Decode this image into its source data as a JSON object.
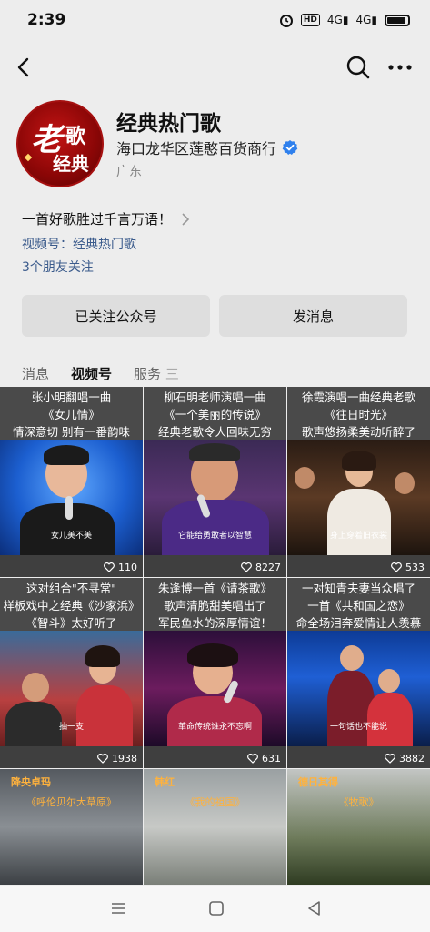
{
  "status_bar": {
    "time": "2:39",
    "hd": "HD",
    "net1": "4G",
    "net2": "4G",
    "battery_level": 0.9
  },
  "nav": {
    "back_icon": "chevron-left-icon",
    "search_icon": "search-icon",
    "more_icon": "more-dots-icon"
  },
  "profile": {
    "avatar_text": [
      "老",
      "歌",
      "经典"
    ],
    "name": "经典热门歌",
    "org": "海口龙华区莲憨百货商行",
    "region": "广东",
    "bio": "一首好歌胜过千言万语！",
    "channel": "视频号：经典热门歌",
    "friends": "3个朋友关注"
  },
  "buttons": {
    "follow": "已关注公众号",
    "message": "发消息"
  },
  "tabs": [
    {
      "label": "消息",
      "active": false
    },
    {
      "label": "视频号",
      "active": true
    },
    {
      "label": "服务",
      "active": false
    }
  ],
  "tab_more": "三",
  "videos": [
    {
      "lines": [
        "张小明翻唱一曲",
        "《女儿情》",
        "情深意切 别有一番韵味"
      ],
      "subtitle": "女儿美不美",
      "likes": "110"
    },
    {
      "lines": [
        "柳石明老师演唱一曲",
        "《一个美丽的传说》",
        "经典老歌令人回味无穷"
      ],
      "subtitle": "它能给勇敢者以智慧",
      "likes": "8227"
    },
    {
      "lines": [
        "徐霞演唱一曲经典老歌",
        "《往日时光》",
        "歌声悠扬柔美动听醉了"
      ],
      "subtitle": "身上穿着旧衣裳",
      "likes": "533"
    },
    {
      "lines": [
        "这对组合\"不寻常\"",
        "样板戏中之经典《沙家浜》",
        "《智斗》太好听了"
      ],
      "subtitle": "抽一支",
      "likes": "1938"
    },
    {
      "lines": [
        "朱逢博一首《请茶歌》",
        "歌声清脆甜美唱出了",
        "军民鱼水的深厚情谊！"
      ],
      "subtitle": "革命传统谁永不忘啊",
      "likes": "631"
    },
    {
      "lines": [
        "一对知青夫妻当众唱了",
        "一首《共和国之恋》",
        "命全场泪奔爱情让人羡慕"
      ],
      "subtitle": "一句话也不能说",
      "likes": "3882"
    }
  ],
  "bottom_videos": [
    {
      "title": "降央卓玛",
      "song": "《呼伦贝尔大草原》"
    },
    {
      "title": "韩红",
      "song": "《我的祖国》"
    },
    {
      "title": "德日其得",
      "song": "《牧歌》"
    }
  ],
  "colors": {
    "link": "#3b5b8c",
    "verified": "#2f80ed",
    "caption": "#ffb23d"
  }
}
